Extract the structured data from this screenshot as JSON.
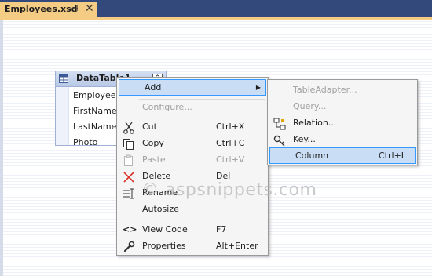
{
  "document_tab": {
    "title": "Employees.xsd",
    "pin_glyph": "⊣",
    "close_glyph": "✕"
  },
  "datatable": {
    "title": "DataTable1",
    "collapse_glyph": "⌃",
    "columns": [
      "Employeeld",
      "FirstName",
      "LastName",
      "Photo"
    ]
  },
  "context_menu": {
    "items": [
      {
        "label": "Add",
        "shortcut": "",
        "submenu_arrow": "▶",
        "icon": "",
        "disabled": false,
        "highlighted": true
      },
      {
        "label": "Configure...",
        "shortcut": "",
        "icon": "",
        "disabled": true
      },
      {
        "label": "Cut",
        "shortcut": "Ctrl+X",
        "icon": "scissors-icon",
        "disabled": false
      },
      {
        "label": "Copy",
        "shortcut": "Ctrl+C",
        "icon": "copy-icon",
        "disabled": false
      },
      {
        "label": "Paste",
        "shortcut": "Ctrl+V",
        "icon": "paste-icon",
        "disabled": true
      },
      {
        "label": "Delete",
        "shortcut": "Del",
        "icon": "delete-icon",
        "disabled": false
      },
      {
        "label": "Rename",
        "shortcut": "",
        "icon": "rename-icon",
        "disabled": false
      },
      {
        "label": "Autosize",
        "shortcut": "",
        "icon": "",
        "disabled": false
      },
      {
        "label": "View Code",
        "shortcut": "F7",
        "icon": "code-icon",
        "disabled": false
      },
      {
        "label": "Properties",
        "shortcut": "Alt+Enter",
        "icon": "wrench-icon",
        "disabled": false
      }
    ]
  },
  "add_submenu": {
    "items": [
      {
        "label": "TableAdapter...",
        "shortcut": "",
        "icon": "",
        "disabled": true
      },
      {
        "label": "Query...",
        "shortcut": "",
        "icon": "",
        "disabled": true
      },
      {
        "label": "Relation...",
        "shortcut": "",
        "icon": "relation-icon",
        "disabled": false
      },
      {
        "label": "Key...",
        "shortcut": "",
        "icon": "key-icon",
        "disabled": false
      },
      {
        "label": "Column",
        "shortcut": "Ctrl+L",
        "icon": "",
        "disabled": false,
        "highlighted": true
      }
    ]
  },
  "watermark": "© aspsnippets.com",
  "colors": {
    "title_bar": "#34497b",
    "active_tab": "#f5cc84",
    "menu_background": "#f5f5f5",
    "menu_highlight": "#c9def5",
    "menu_highlight_border": "#3399ff",
    "disabled_text": "#a0a0a0",
    "delete_icon": "#d9342b"
  }
}
